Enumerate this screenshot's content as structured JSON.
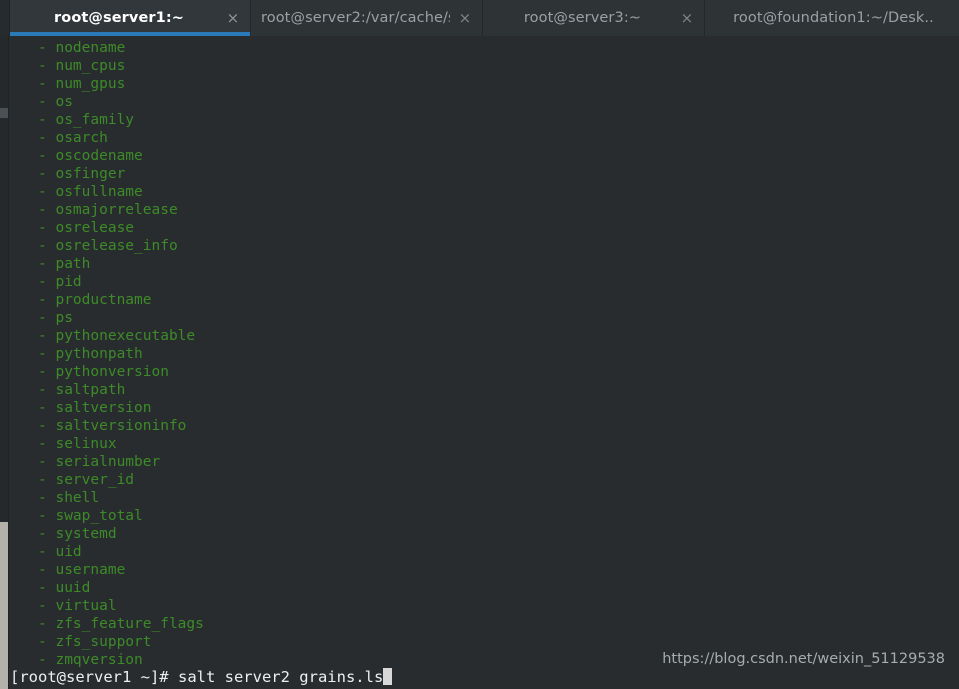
{
  "window": {
    "title": "root@server1:~",
    "accent_color": "#2a7ab9",
    "terminal_bg": "#282c2e",
    "terminal_fg": "#3d8b28",
    "prompt_fg": "#eceff1"
  },
  "tabbar": {
    "tabs": [
      {
        "label": "root@server1:~",
        "active": true,
        "close_icon": "×"
      },
      {
        "label": "root@server2:/var/cache/s…",
        "active": false,
        "close_icon": "×"
      },
      {
        "label": "root@server3:~",
        "active": false,
        "close_icon": "×"
      },
      {
        "label": "root@foundation1:~/Desk..",
        "active": false,
        "close_icon": ""
      }
    ]
  },
  "terminal": {
    "output_lines": [
      "- nodename",
      "- num_cpus",
      "- num_gpus",
      "- os",
      "- os_family",
      "- osarch",
      "- oscodename",
      "- osfinger",
      "- osfullname",
      "- osmajorrelease",
      "- osrelease",
      "- osrelease_info",
      "- path",
      "- pid",
      "- productname",
      "- ps",
      "- pythonexecutable",
      "- pythonpath",
      "- pythonversion",
      "- saltpath",
      "- saltversion",
      "- saltversioninfo",
      "- selinux",
      "- serialnumber",
      "- server_id",
      "- shell",
      "- swap_total",
      "- systemd",
      "- uid",
      "- username",
      "- uuid",
      "- virtual",
      "- zfs_feature_flags",
      "- zfs_support",
      "- zmqversion"
    ],
    "prompt": "[root@server1 ~]# ",
    "command": "salt server2 grains.ls",
    "cursor": "block"
  },
  "watermark": {
    "text": "https://blog.csdn.net/weixin_51129538"
  }
}
